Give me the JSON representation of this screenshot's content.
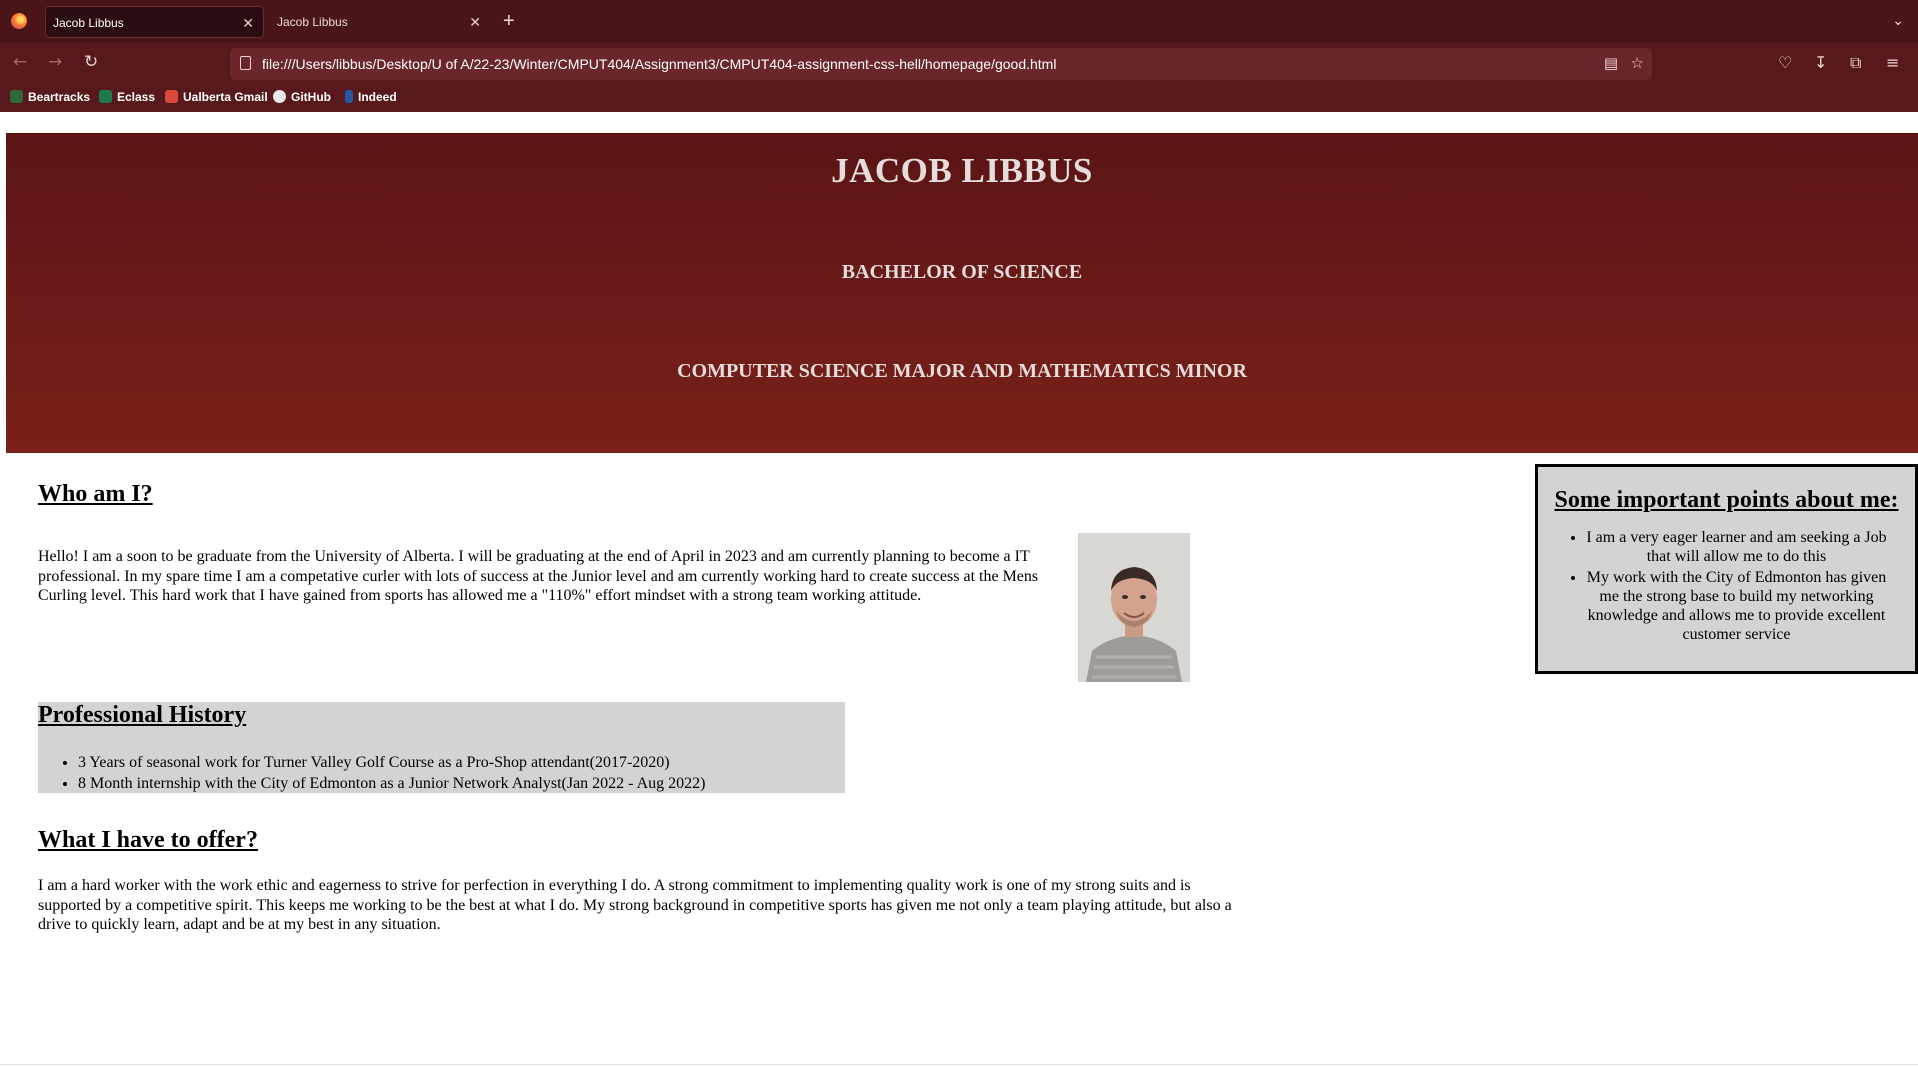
{
  "browser": {
    "tabs": [
      {
        "label": "Jacob Libbus",
        "active": true
      },
      {
        "label": "Jacob Libbus",
        "active": false
      }
    ],
    "new_tab_label": "+",
    "url": "file:///Users/libbus/Desktop/U of A/22-23/Winter/CMPUT404/Assignment3/CMPUT404-assignment-css-hell/homepage/good.html",
    "bookmarks": [
      {
        "label": "Beartracks",
        "icon": "beartracks-icon",
        "color": "#2e6b3a"
      },
      {
        "label": "Eclass",
        "icon": "eclass-icon",
        "color": "#1e7a4a"
      },
      {
        "label": "Ualberta Gmail",
        "icon": "gmail-icon",
        "color": "#d94a3a"
      },
      {
        "label": "GitHub",
        "icon": "github-icon",
        "color": "#e8e8e8"
      },
      {
        "label": "Indeed",
        "icon": "indeed-icon",
        "color": "#2557a7"
      }
    ]
  },
  "hero": {
    "name": "JACOB LIBBUS",
    "degree": "BACHELOR OF SCIENCE",
    "major": "COMPUTER SCIENCE MAJOR AND MATHEMATICS MINOR"
  },
  "about": {
    "heading": "Who am I?",
    "text": "Hello! I am a soon to be graduate from the University of Alberta. I will be graduating at the end of April in 2023 and am currently planning to become a IT professional. In my spare time I am a competative curler with lots of success at the Junior level and am currently working hard to create success at the Mens Curling level. This hard work that I have gained from sports has allowed me a \"110%\" effort mindset with a strong team working attitude."
  },
  "history": {
    "heading": "Professional History",
    "items": [
      "3 Years of seasonal work for Turner Valley Golf Course as a Pro-Shop attendant(2017-2020)",
      "8 Month internship with the City of Edmonton as a Junior Network Analyst(Jan 2022 - Aug 2022)"
    ]
  },
  "offer": {
    "heading": "What I have to offer?",
    "text": "I am a hard worker with the work ethic and eagerness to strive for perfection in everything I do. A strong commitment to implementing quality work is one of my strong suits and is supported by a competitive spirit. This keeps me working to be the best at what I do. My strong background in competitive sports has given me not only a team playing attitude, but also a drive to quickly learn, adapt and be at my best in any situation."
  },
  "points": {
    "heading": "Some important points about me:",
    "items": [
      "I am a very eager learner and am seeking a Job that will allow me to do this",
      "My work with the City of Edmonton has given me the strong base to build my networking knowledge and allows me to provide excellent customer service"
    ]
  }
}
